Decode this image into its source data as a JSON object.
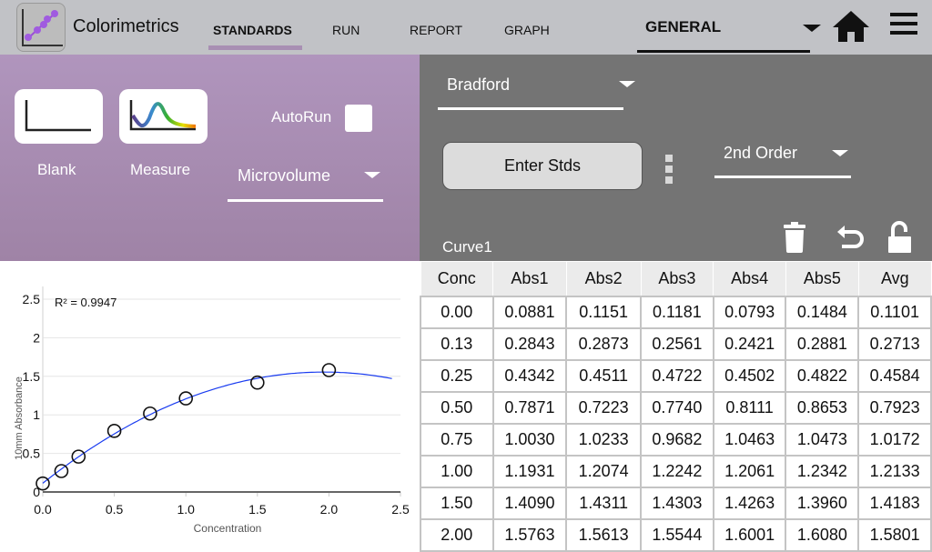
{
  "header": {
    "app_name": "Colorimetrics",
    "tabs": [
      {
        "label": "STANDARDS",
        "active": true
      },
      {
        "label": "RUN"
      },
      {
        "label": "REPORT"
      },
      {
        "label": "GRAPH"
      }
    ],
    "mode": "GENERAL",
    "icons": [
      "home-icon",
      "menu-icon"
    ]
  },
  "controls": {
    "blank_label": "Blank",
    "measure_label": "Measure",
    "autorun_label": "AutoRun",
    "autorun_checked": false,
    "sample_type": "Microvolume",
    "assay": "Bradford",
    "enter_stds_label": "Enter Stds",
    "fit": "2nd Order",
    "curve_name": "Curve1"
  },
  "colors": {
    "accent": "#a88fb3",
    "panel_gray": "#747474",
    "fit_line": "#1a3cf0"
  },
  "chart_data": {
    "type": "scatter",
    "r2_label": "R² = 0.9947",
    "xlabel": "Concentration",
    "ylabel": "10mm Absorbance",
    "xlim": [
      0,
      2.5
    ],
    "ylim": [
      0,
      2.5
    ],
    "xticks": [
      "0.0",
      "0.5",
      "1.0",
      "1.5",
      "2.0",
      "2.5"
    ],
    "yticks": [
      "0",
      "0.5",
      "1",
      "1.5",
      "2",
      "2.5"
    ],
    "grid": true,
    "x": [
      0,
      0.13,
      0.25,
      0.5,
      0.75,
      1.0,
      1.5,
      2.0
    ],
    "y": [
      0.1101,
      0.2713,
      0.4584,
      0.7923,
      1.0172,
      1.2133,
      1.4183,
      1.5801
    ],
    "fit": "2nd order polynomial"
  },
  "table": {
    "columns": [
      "Conc",
      "Abs1",
      "Abs2",
      "Abs3",
      "Abs4",
      "Abs5",
      "Avg"
    ],
    "rows": [
      [
        "0.00",
        "0.0881",
        "0.1151",
        "0.1181",
        "0.0793",
        "0.1484",
        "0.1101"
      ],
      [
        "0.13",
        "0.2843",
        "0.2873",
        "0.2561",
        "0.2421",
        "0.2881",
        "0.2713"
      ],
      [
        "0.25",
        "0.4342",
        "0.4511",
        "0.4722",
        "0.4502",
        "0.4822",
        "0.4584"
      ],
      [
        "0.50",
        "0.7871",
        "0.7223",
        "0.7740",
        "0.8111",
        "0.8653",
        "0.7923"
      ],
      [
        "0.75",
        "1.0030",
        "1.0233",
        "0.9682",
        "1.0463",
        "1.0473",
        "1.0172"
      ],
      [
        "1.00",
        "1.1931",
        "1.2074",
        "1.2242",
        "1.2061",
        "1.2342",
        "1.2133"
      ],
      [
        "1.50",
        "1.4090",
        "1.4311",
        "1.4303",
        "1.4263",
        "1.3960",
        "1.4183"
      ],
      [
        "2.00",
        "1.5763",
        "1.5613",
        "1.5544",
        "1.6001",
        "1.6080",
        "1.5801"
      ]
    ]
  }
}
